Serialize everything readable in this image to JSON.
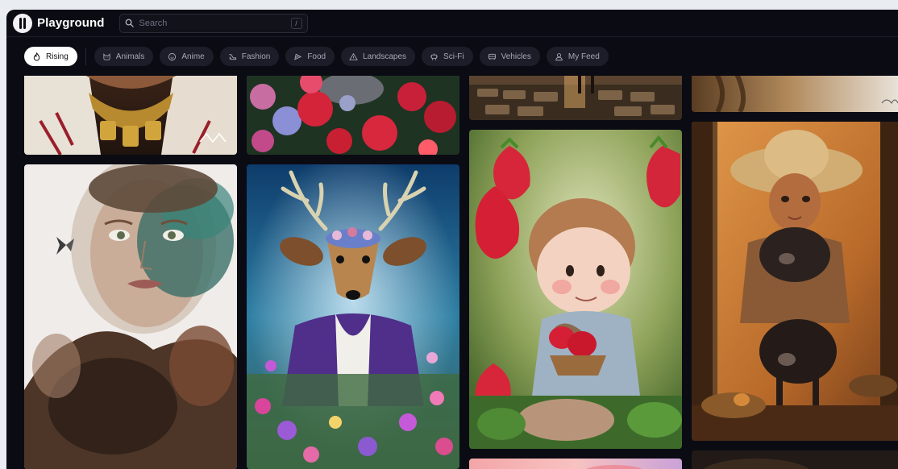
{
  "brand": {
    "name": "Playground"
  },
  "search": {
    "placeholder": "Search",
    "shortcut": "/"
  },
  "filters": [
    {
      "label": "Rising",
      "icon": "flame-icon",
      "active": true
    },
    {
      "label": "Animals",
      "icon": "cat-icon"
    },
    {
      "label": "Anime",
      "icon": "smile-icon"
    },
    {
      "label": "Fashion",
      "icon": "heel-icon"
    },
    {
      "label": "Food",
      "icon": "cake-icon"
    },
    {
      "label": "Landscapes",
      "icon": "mountain-icon"
    },
    {
      "label": "Sci-Fi",
      "icon": "robot-icon"
    },
    {
      "label": "Vehicles",
      "icon": "car-icon"
    },
    {
      "label": "My Feed",
      "icon": "user-icon"
    }
  ],
  "colors": {
    "app_bg": "#0b0b13",
    "chip_bg": "#1d1d29",
    "chip_active_bg": "#ffffff",
    "page_bg": "#e9edf2"
  },
  "gallery": {
    "images": [
      {
        "name": "woman-gold-necklace-image"
      },
      {
        "name": "red-flowers-image"
      },
      {
        "name": "cobblestone-path-image"
      },
      {
        "name": "partial-top-right-image"
      },
      {
        "name": "watercolor-woman-portrait-image"
      },
      {
        "name": "deer-purple-coat-image"
      },
      {
        "name": "child-strawberries-image"
      },
      {
        "name": "girl-hat-pigs-image"
      },
      {
        "name": "sunset-sky-image"
      },
      {
        "name": "dark-bottom-right-image"
      }
    ]
  }
}
